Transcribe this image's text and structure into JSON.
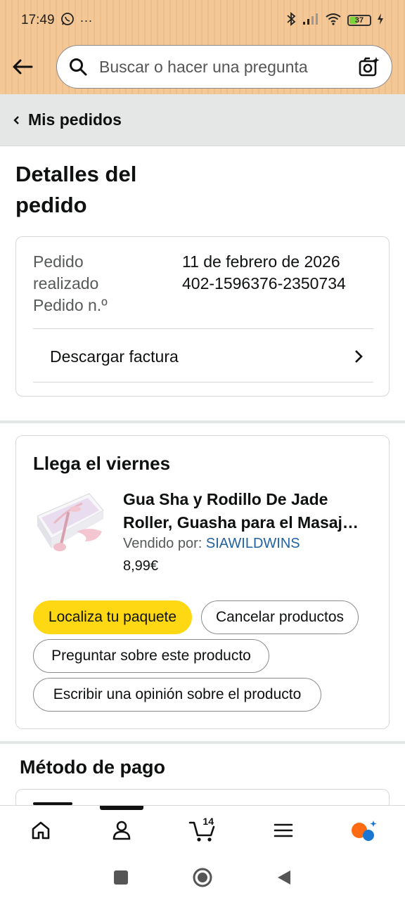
{
  "status_bar": {
    "time": "17:49",
    "more": "···",
    "battery": "37"
  },
  "search": {
    "placeholder": "Buscar o hacer una pregunta"
  },
  "breadcrumb": {
    "label": "Mis pedidos"
  },
  "page": {
    "title_line1": "Detalles del",
    "title_line2": "pedido"
  },
  "order_info": {
    "label_line1": "Pedido",
    "label_line2": "realizado",
    "label_line3": "Pedido n.º",
    "date": "11 de febrero de 2026",
    "number": "402-1596376-2350734",
    "invoice_label": "Descargar factura"
  },
  "delivery": {
    "title": "Llega el viernes",
    "product_title_line1": "Gua Sha y Rodillo De Jade",
    "product_title_line2": "Roller, Guasha para el Masaj…",
    "seller_prefix": "Vendido por:",
    "seller_name": "SIAWILDWINS",
    "price": "8,99€",
    "actions": {
      "track": "Localiza tu paquete",
      "cancel": "Cancelar productos",
      "ask": "Preguntar sobre este producto",
      "review": "Escribir una opinión sobre el producto"
    }
  },
  "payment": {
    "title": "Método de pago"
  },
  "bottom_nav": {
    "cart_count": "14"
  },
  "colors": {
    "header_bg": "#f3c896",
    "primary_button": "#ffd814",
    "link": "#2162a1",
    "rufus": "#ff6a13"
  }
}
